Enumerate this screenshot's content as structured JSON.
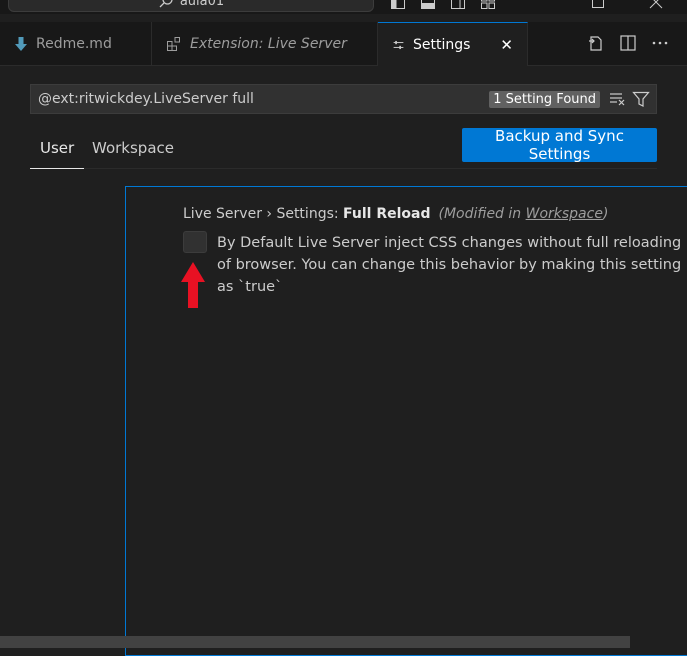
{
  "titlebar": {
    "command_center_text": "aula01"
  },
  "tabs": [
    {
      "label": "Redme.md",
      "icon": "markdown-download-icon",
      "color": "#519aba"
    },
    {
      "label": "Extension: Live Server",
      "icon": "extensions-icon"
    },
    {
      "label": "Settings",
      "icon": "settings-sliders-icon",
      "close": "✕"
    }
  ],
  "search": {
    "query": "@ext:ritwickdey.LiveServer full",
    "found": "1 Setting Found"
  },
  "scope_tabs": {
    "user": "User",
    "workspace": "Workspace"
  },
  "sync_button": "Backup and Sync Settings",
  "setting": {
    "category": "Live Server › Settings: ",
    "name": "Full Reload",
    "modified_prefix": "(Modified in ",
    "modified_link": "Workspace",
    "modified_suffix": ")",
    "checked": false,
    "description": "By Default Live Server inject CSS changes without full reloading of browser. You can change this behavior by making this setting as `true`"
  },
  "colors": {
    "accent": "#0078d4",
    "annotation_arrow": "#e81123"
  }
}
